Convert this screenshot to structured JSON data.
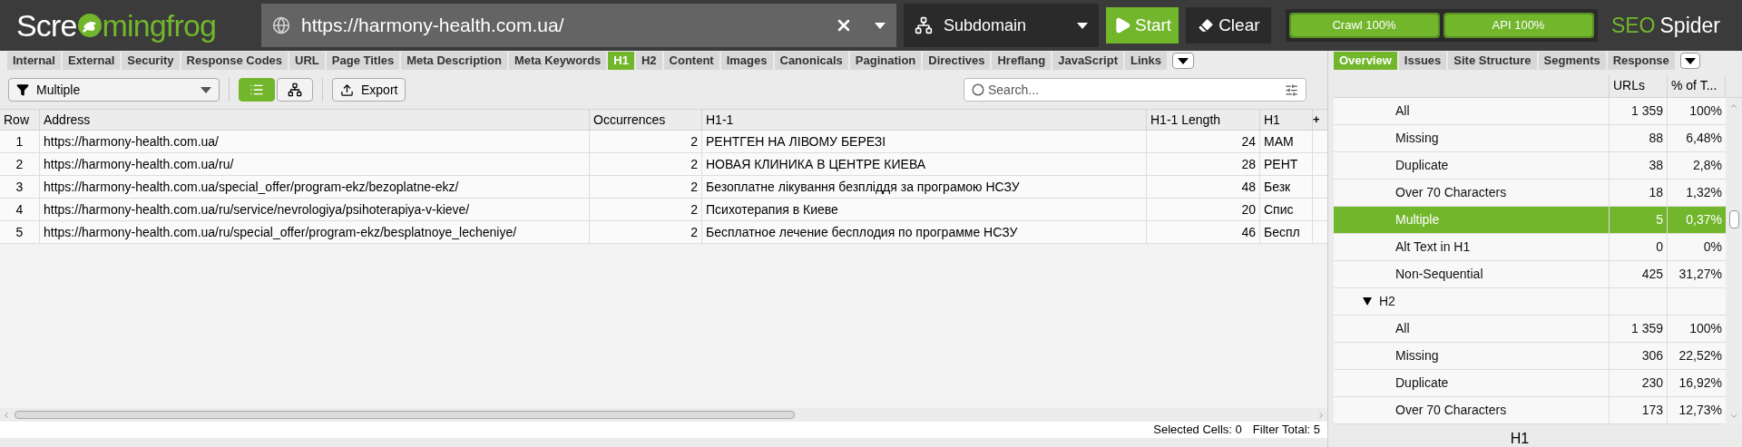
{
  "logo": {
    "text_1": "Scre",
    "text_2": "mingfrog"
  },
  "url_bar": {
    "value": "https://harmony-health.com.ua/"
  },
  "mode_dropdown": {
    "value": "Subdomain"
  },
  "buttons": [
    {
      "kind": "start",
      "label": "Start"
    },
    {
      "kind": "clear",
      "label": "Clear"
    }
  ],
  "progress": [
    {
      "label": "Crawl 100%",
      "level": 1
    },
    {
      "label": "API 100%",
      "level": 1
    }
  ],
  "product": {
    "text_1": "SEO",
    "text_2": "Spider"
  },
  "tabs": [
    {
      "label": "Internal",
      "selected": false
    },
    {
      "label": "External",
      "selected": false
    },
    {
      "label": "Security",
      "selected": false
    },
    {
      "label": "Response Codes",
      "selected": false
    },
    {
      "label": "URL",
      "selected": false
    },
    {
      "label": "Page Titles",
      "selected": false
    },
    {
      "label": "Meta Description",
      "selected": false
    },
    {
      "label": "Meta Keywords",
      "selected": false
    },
    {
      "label": "H1",
      "selected": true
    },
    {
      "label": "H2",
      "selected": false
    },
    {
      "label": "Content",
      "selected": false
    },
    {
      "label": "Images",
      "selected": false
    },
    {
      "label": "Canonicals",
      "selected": false
    },
    {
      "label": "Pagination",
      "selected": false
    },
    {
      "label": "Directives",
      "selected": false
    },
    {
      "label": "Hreflang",
      "selected": false
    },
    {
      "label": "JavaScript",
      "selected": false
    },
    {
      "label": "Links",
      "selected": false
    }
  ],
  "filter": {
    "value": "Multiple"
  },
  "view_toggle": [
    {
      "kind": "list",
      "selected": true
    },
    {
      "kind": "tree",
      "selected": false
    }
  ],
  "export_button": {
    "label": "Export"
  },
  "search": {
    "placeholder": "Search..."
  },
  "table": {
    "columns": [
      "Row",
      "Address",
      "Occurrences",
      "H1-1",
      "H1-1 Length",
      "H1"
    ],
    "add_column": "+",
    "rows": [
      [
        "1",
        "https://harmony-health.com.ua/",
        "2",
        "РЕНТГЕН НА ЛІВОМУ БЕРЕЗІ",
        "24",
        "МАМ"
      ],
      [
        "2",
        "https://harmony-health.com.ua/ru/",
        "2",
        "НОВАЯ КЛИНИКА В ЦЕНТРЕ КИЕВА",
        "28",
        "РЕНТ"
      ],
      [
        "3",
        "https://harmony-health.com.ua/special_offer/program-ekz/bezoplatne-ekz/",
        "2",
        "Безоплатне лікування безпліддя за програмою НСЗУ",
        "48",
        "Безк"
      ],
      [
        "4",
        "https://harmony-health.com.ua/ru/service/nevrologiya/psihoterapiya-v-kieve/",
        "2",
        "Психотерапия в Киеве",
        "20",
        "Спис"
      ],
      [
        "5",
        "https://harmony-health.com.ua/ru/special_offer/program-ekz/besplatnoye_lecheniye/",
        "2",
        "Бесплатное лечение бесплодия по программе НСЗУ",
        "46",
        "Беспл"
      ]
    ]
  },
  "status_bar": [
    {
      "label": "Selected Cells:",
      "value": "0"
    },
    {
      "label": "Filter Total:",
      "value": "5"
    }
  ],
  "right_tabs": [
    {
      "label": "Overview",
      "selected": true
    },
    {
      "label": "Issues",
      "selected": false
    },
    {
      "label": "Site Structure",
      "selected": false
    },
    {
      "label": "Segments",
      "selected": false
    },
    {
      "label": "Response",
      "selected": false
    }
  ],
  "overview": {
    "columns": [
      "URLs",
      "% of T..."
    ],
    "tree": [
      {
        "label": "All",
        "urls": "1 359",
        "percent": "100%",
        "selected": false
      },
      {
        "label": "Missing",
        "urls": "88",
        "percent": "6,48%",
        "selected": false
      },
      {
        "label": "Duplicate",
        "urls": "38",
        "percent": "2,8%",
        "selected": false
      },
      {
        "label": "Over 70 Characters",
        "urls": "18",
        "percent": "1,32%",
        "selected": false
      },
      {
        "label": "Multiple",
        "urls": "5",
        "percent": "0,37%",
        "selected": true
      },
      {
        "label": "Alt Text in H1",
        "urls": "0",
        "percent": "0%",
        "selected": false
      },
      {
        "label": "Non-Sequential",
        "urls": "425",
        "percent": "31,27%",
        "selected": false
      },
      {
        "label": "H2",
        "selected": false,
        "expanded": true,
        "children": [
          {
            "label": "All",
            "urls": "1 359",
            "percent": "100%",
            "selected": false
          },
          {
            "label": "Missing",
            "urls": "306",
            "percent": "22,52%",
            "selected": false
          },
          {
            "label": "Duplicate",
            "urls": "230",
            "percent": "16,92%",
            "selected": false
          },
          {
            "label": "Over 70 Characters",
            "urls": "173",
            "percent": "12,73%",
            "selected": false
          }
        ]
      }
    ]
  },
  "chart_title": "H1"
}
